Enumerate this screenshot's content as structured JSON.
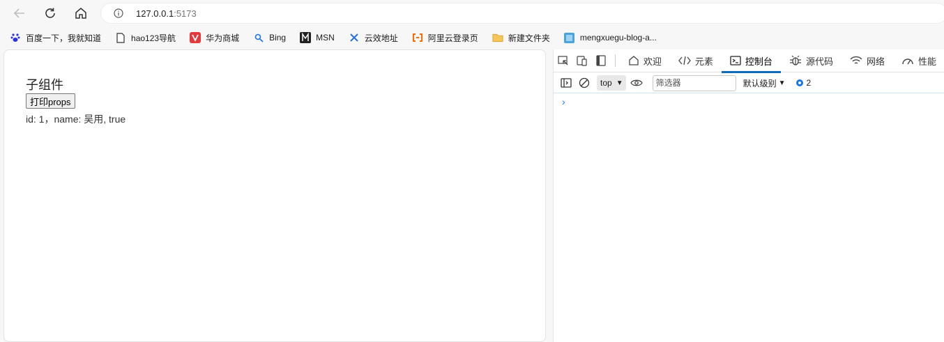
{
  "browser": {
    "url_host": "127.0.0.1",
    "url_port": ":5173"
  },
  "bookmarks": [
    {
      "label": "百度一下，我就知道",
      "icon": "baidu-paw-icon"
    },
    {
      "label": "hao123导航",
      "icon": "page-icon"
    },
    {
      "label": "华为商城",
      "icon": "vmall-icon"
    },
    {
      "label": "Bing",
      "icon": "bing-search-icon"
    },
    {
      "label": "MSN",
      "icon": "msn-icon"
    },
    {
      "label": "云效地址",
      "icon": "yunxiao-icon"
    },
    {
      "label": "阿里云登录页",
      "icon": "aliyun-icon"
    },
    {
      "label": "新建文件夹",
      "icon": "folder-icon"
    },
    {
      "label": "mengxuegu-blog-a...",
      "icon": "blog-favicon-icon"
    }
  ],
  "page": {
    "heading": "子组件",
    "button_label": "打印props",
    "info_text": "id: 1，name: 吴用, true"
  },
  "devtools": {
    "tabs": [
      {
        "label": "欢迎",
        "icon": "home-icon"
      },
      {
        "label": "元素",
        "icon": "code-icon"
      },
      {
        "label": "控制台",
        "icon": "console-icon",
        "active": true
      },
      {
        "label": "源代码",
        "icon": "bug-icon"
      },
      {
        "label": "网络",
        "icon": "wifi-icon"
      },
      {
        "label": "性能",
        "icon": "gauge-icon"
      }
    ],
    "context": "top",
    "filter_placeholder": "筛选器",
    "level_label": "默认级别",
    "message_count": "2",
    "prompt_symbol": "›",
    "accent_color": "#0f6cbd"
  }
}
